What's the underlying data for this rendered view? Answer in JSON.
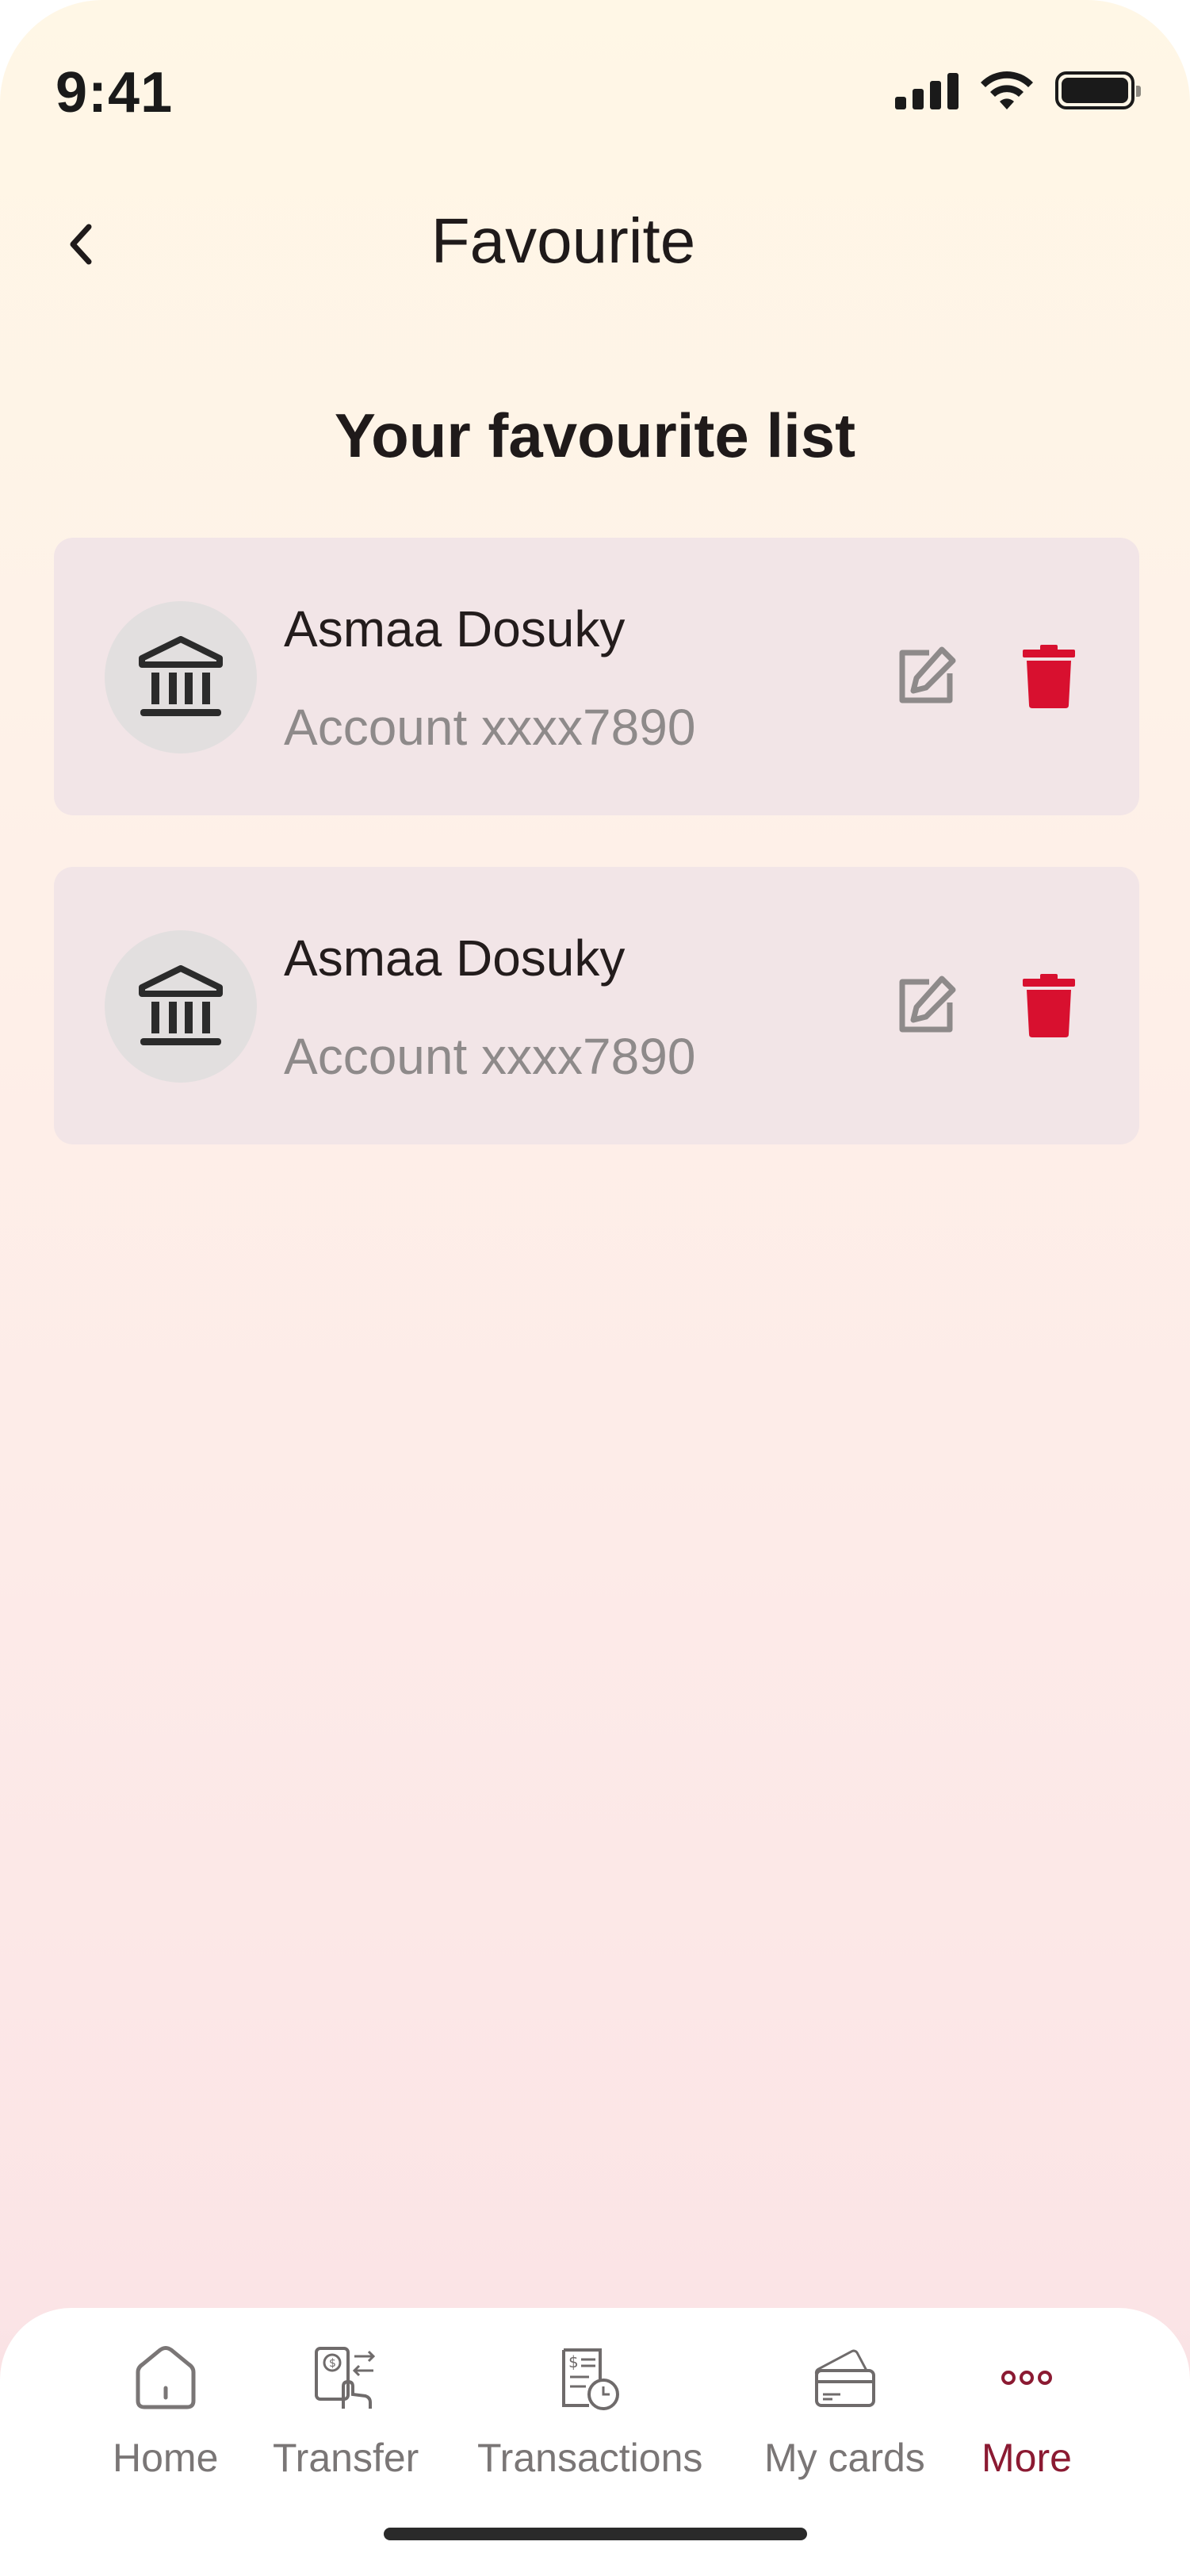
{
  "status_bar": {
    "time": "9:41"
  },
  "header": {
    "title": "Favourite"
  },
  "section": {
    "title": "Your favourite list"
  },
  "favourites": [
    {
      "name": "Asmaa Dosuky",
      "account": "Account xxxx7890",
      "icon": "bank-icon"
    },
    {
      "name": "Asmaa Dosuky",
      "account": "Account xxxx7890",
      "icon": "bank-icon"
    }
  ],
  "nav": {
    "items": [
      {
        "label": "Home",
        "icon": "home-icon",
        "active": false
      },
      {
        "label": "Transfer",
        "icon": "transfer-icon",
        "active": false
      },
      {
        "label": "Transactions",
        "icon": "transactions-icon",
        "active": false
      },
      {
        "label": "My cards",
        "icon": "cards-icon",
        "active": false
      },
      {
        "label": "More",
        "icon": "more-icon",
        "active": true
      }
    ]
  },
  "colors": {
    "accent": "#8b1a32",
    "delete": "#d8102f",
    "card_bg": "#f2e5e7"
  }
}
